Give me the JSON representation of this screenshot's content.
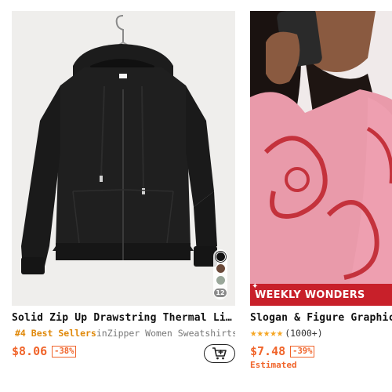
{
  "products": [
    {
      "title": "Solid Zip Up Drawstring Thermal Lined Hoodie",
      "best_seller_rank": "#4 Best Sellers",
      "category_prefix": "in",
      "category": "Zipper Women Sweatshirts",
      "price": "$8.06",
      "discount": "-38%",
      "swatch_count": "12",
      "swatch_colors": [
        "#111111",
        "#6b4a3a",
        "#9aa79a"
      ],
      "cart_icon": "add-to-cart-icon",
      "image_icon": "black-zip-hoodie-image"
    },
    {
      "title": "Slogan & Figure Graphic Hoodie",
      "rating_stars": 5,
      "rating_count": "(1000+)",
      "price": "$7.48",
      "discount": "-39%",
      "estimated_label": "Estimated",
      "promo_banner": "WEEKLY WONDERS",
      "image_icon": "pink-graphic-hoodie-photo"
    }
  ],
  "colors": {
    "price": "#f0642a",
    "rank": "#e0890a",
    "banner": "#c8202a",
    "star": "#f5a623"
  }
}
